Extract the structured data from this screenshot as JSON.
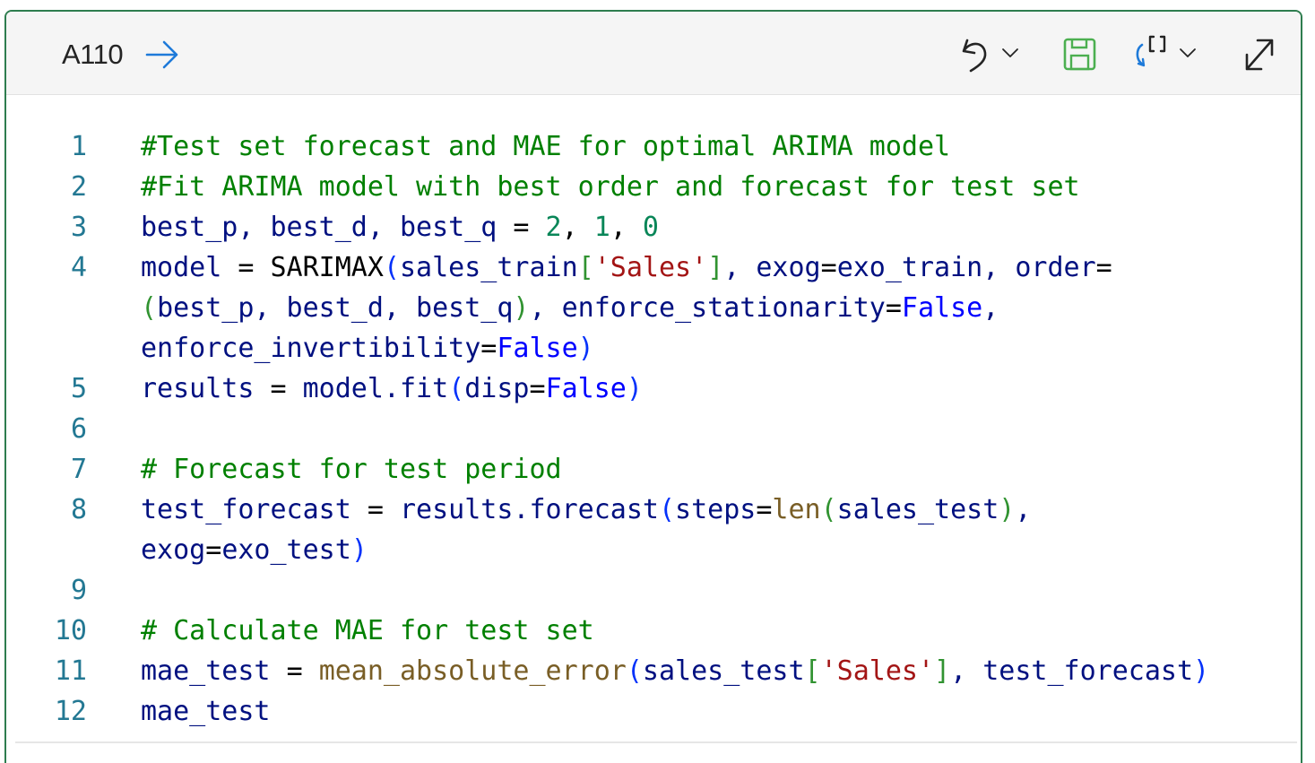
{
  "header": {
    "cell_ref": "A110"
  },
  "toolbar": {
    "icons": [
      "arrow-right-icon",
      "undo-icon",
      "chevron-down-icon",
      "save-icon",
      "reset-icon",
      "chevron-down-icon",
      "expand-icon"
    ]
  },
  "code": {
    "line_numbers": [
      "1",
      "2",
      "3",
      "4",
      "5",
      "6",
      "7",
      "8",
      "9",
      "10",
      "11",
      "12"
    ],
    "l1": "#Test set forecast and MAE for optimal ARIMA model",
    "l2": "#Fit ARIMA model with best order and forecast for test set",
    "l3": {
      "a": "best_p, best_d, best_q ",
      "eq": "=",
      "sp": " ",
      "n1": "2",
      "c1": ", ",
      "n2": "1",
      "c2": ", ",
      "n3": "0"
    },
    "l4a": {
      "a": "model ",
      "eq": "=",
      "b": " SARIMAX",
      "p1": "(",
      "c": "sales_train",
      "b1": "[",
      "s": "'Sales'",
      "b2": "]",
      "d": ", exog",
      "eq2": "=",
      "e": "exo_train, order",
      "eq3": "="
    },
    "l4b": {
      "p1": "(",
      "a": "best_p, best_d, best_q",
      "p2": ")",
      "b": ", enforce_stationarity",
      "eq": "=",
      "kw": "False",
      "c": ","
    },
    "l4c": {
      "a": "enforce_invertibility",
      "eq": "=",
      "kw": "False",
      "p": ")"
    },
    "l5": {
      "a": "results ",
      "eq": "=",
      "b": " model.fit",
      "p1": "(",
      "c": "disp",
      "eq2": "=",
      "kw": "False",
      "p2": ")"
    },
    "l7": "# Forecast for test period",
    "l8a": {
      "a": "test_forecast ",
      "eq": "=",
      "b": " results.forecast",
      "p1": "(",
      "c": "steps",
      "eq2": "=",
      "fn": "len",
      "p2": "(",
      "d": "sales_test",
      "p3": ")",
      "e": ","
    },
    "l8b": {
      "a": "exog",
      "eq": "=",
      "b": "exo_test",
      "p": ")"
    },
    "l10": "# Calculate MAE for test set",
    "l11": {
      "a": "mae_test ",
      "eq": "=",
      "sp": " ",
      "fn": "mean_absolute_error",
      "p1": "(",
      "b": "sales_test",
      "b1": "[",
      "s": "'Sales'",
      "b2": "]",
      "c": ", test_forecast",
      "p2": ")"
    },
    "l12": "mae_test"
  },
  "colors": {
    "border": "#2e7d4f",
    "header_bg": "#f5f5f5",
    "line_number": "#237893",
    "identifier": "#001080",
    "comment": "#008000",
    "number": "#098658",
    "string": "#a31515",
    "keyword": "#0000ff",
    "function": "#795e26",
    "icon_blue": "#1e7ad9",
    "icon_green": "#4caf50"
  }
}
